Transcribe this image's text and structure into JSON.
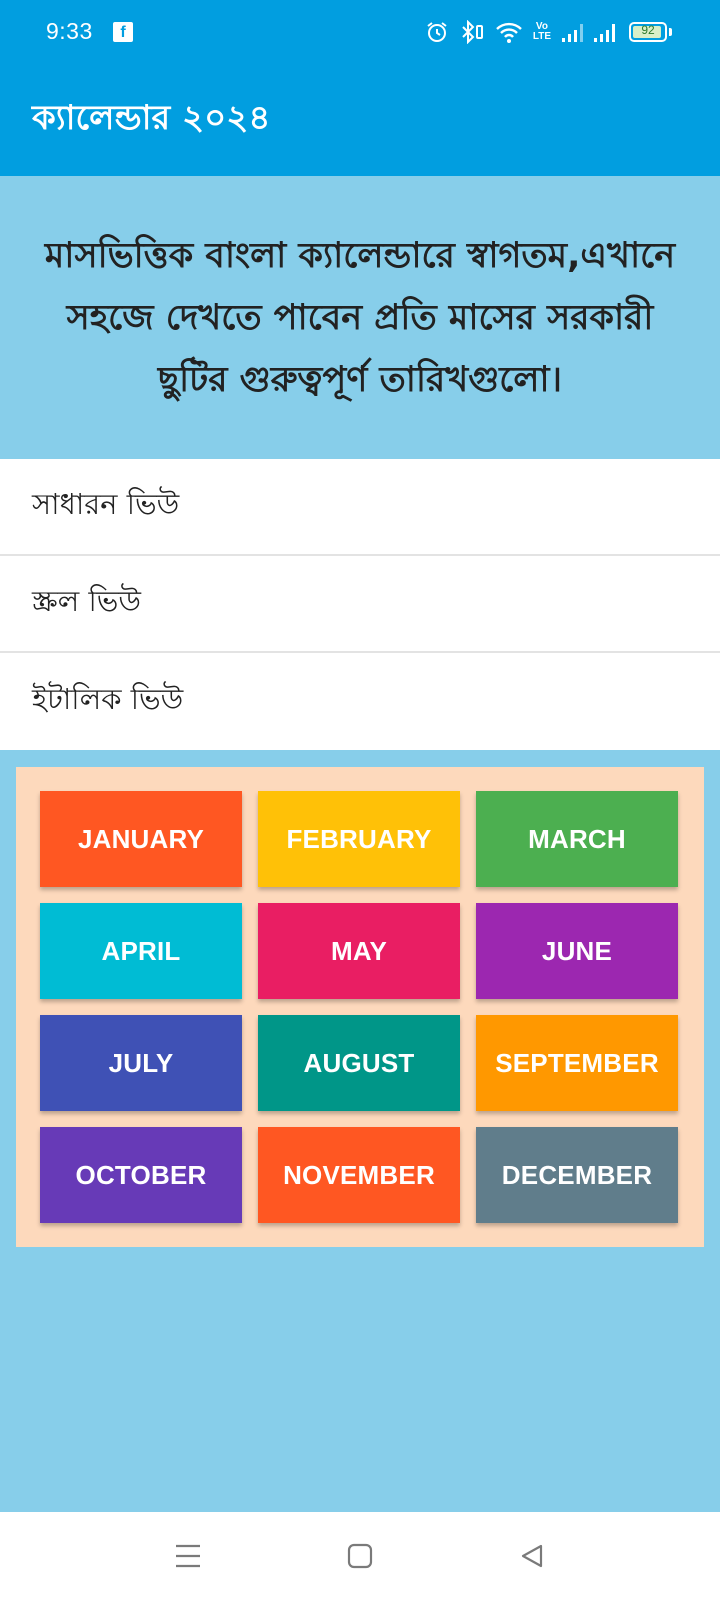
{
  "status_bar": {
    "time": "9:33",
    "battery": "92",
    "battery_level": 0.92,
    "volte_top": "Vo",
    "volte_bottom": "LTE",
    "icons": [
      "facebook-icon",
      "alarm-icon",
      "bluetooth-icon",
      "wifi-icon",
      "volte-icon",
      "signal-icon",
      "signal-icon",
      "battery-icon"
    ]
  },
  "app_bar": {
    "title": "ক্যালেন্ডার ২০২৪",
    "background": "#019ee0"
  },
  "welcome": {
    "text": "মাসভিত্তিক বাংলা ক্যালেন্ডারে স্বাগতম,এখানে সহজে দেখতে পাবেন প্রতি মাসের সরকারী ছুটির গুরুত্বপূর্ণ তারিখগুলো।",
    "background": "#87ceea"
  },
  "views": [
    {
      "label": "সাধারন ভিউ"
    },
    {
      "label": "স্ক্রল ভিউ"
    },
    {
      "label": "ইটালিক ভিউ"
    }
  ],
  "months": [
    {
      "label": "JANUARY",
      "color": "#ff5722"
    },
    {
      "label": "FEBRUARY",
      "color": "#ffc107"
    },
    {
      "label": "MARCH",
      "color": "#4caf50"
    },
    {
      "label": "APRIL",
      "color": "#00bcd4"
    },
    {
      "label": "MAY",
      "color": "#e91e63"
    },
    {
      "label": "JUNE",
      "color": "#9c27b0"
    },
    {
      "label": "JULY",
      "color": "#3f51b5"
    },
    {
      "label": "AUGUST",
      "color": "#009688"
    },
    {
      "label": "SEPTEMBER",
      "color": "#ff9800"
    },
    {
      "label": "OCTOBER",
      "color": "#673ab7"
    },
    {
      "label": "NOVEMBER",
      "color": "#ff5722"
    },
    {
      "label": "DECEMBER",
      "color": "#607d8b"
    }
  ],
  "month_panel_color": "#fdd9bc",
  "nav_bar": {
    "icons": [
      "menu-icon",
      "home-icon",
      "back-icon"
    ]
  }
}
